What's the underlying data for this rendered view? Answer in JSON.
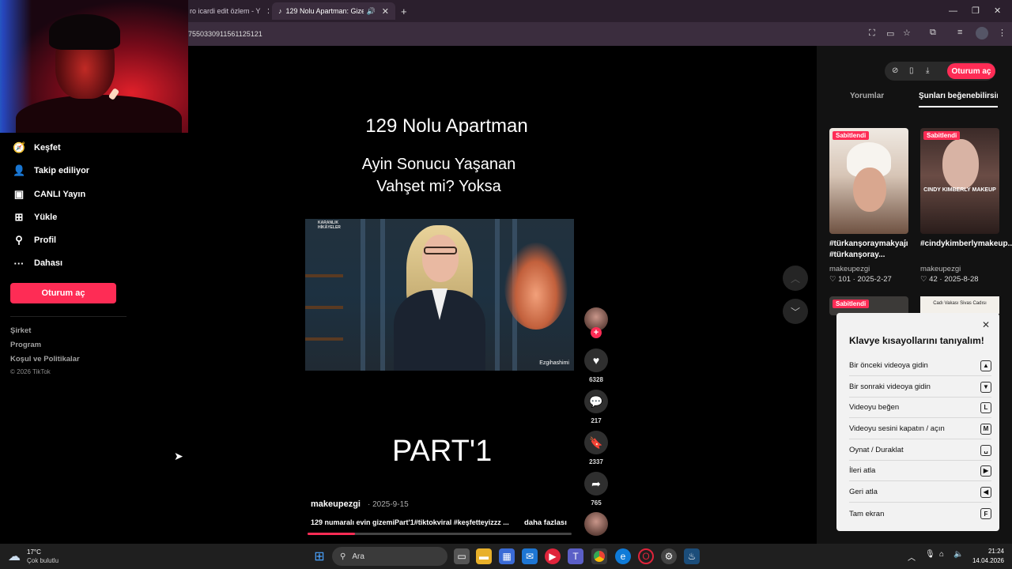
{
  "browser": {
    "tabs": [
      {
        "title": "ro icardi edit özlem - Y"
      },
      {
        "title": "129 Nolu Apartman: Gizem"
      }
    ],
    "url": "7550330911561125121"
  },
  "sidebar": {
    "items": [
      {
        "label": "Keşfet",
        "icon": "compass-icon"
      },
      {
        "label": "Takip ediliyor",
        "icon": "following-icon"
      },
      {
        "label": "CANLI Yayın",
        "icon": "live-icon"
      },
      {
        "label": "Yükle",
        "icon": "upload-icon"
      },
      {
        "label": "Profil",
        "icon": "profile-icon"
      },
      {
        "label": "Dahası",
        "icon": "more-icon"
      }
    ],
    "login_label": "Oturum aç",
    "footer_links": [
      "Şirket",
      "Program",
      "Koşul ve Politikalar"
    ],
    "copyright": "© 2026 TikTok"
  },
  "video": {
    "title": "129 Nolu Apartman",
    "subtitle_line1": "Ayin Sonucu Yaşanan",
    "subtitle_line2": "Vahşet mi? Yoksa",
    "brand_line1": "KARANLIK",
    "brand_line2": "HİKÂYELER",
    "watermark": "Ezgihashimi",
    "part_label": "PART'1",
    "author": "makeupezgi",
    "date": "· 2025-9-15",
    "description": "129 numaralı evin gizemiPart'1#tiktokviral #keşfetteyizzz ...",
    "more_label": "daha fazlası",
    "progress": 0.18
  },
  "actions": {
    "likes": "6328",
    "comments": "217",
    "saves": "2337",
    "shares": "765"
  },
  "right_panel": {
    "login_label": "Oturum aç",
    "tab_comments": "Yorumlar",
    "tab_suggested": "Şunları beğenebilirsin",
    "cards": [
      {
        "pinned": "Sabitlendi",
        "title": "#türkanşoraymakyajı #türkanşoray...",
        "user": "makeupezgi",
        "likes": "101",
        "date": "2025-2-27"
      },
      {
        "pinned": "Sabitlendi",
        "title": "#cindykimberlymakeup...",
        "user": "makeupezgi",
        "likes": "42",
        "date": "2025-8-28",
        "overlay": "CINDY KIMBERLY MAKEUP"
      },
      {
        "pinned": "Sabitlendi"
      },
      {
        "overlay": "Cadı Vakası Sivas Cadısı"
      }
    ]
  },
  "shortcuts": {
    "title": "Klavye kısayollarını tanıyalım!",
    "rows": [
      {
        "label": "Bir önceki videoya gidin",
        "key": "▲"
      },
      {
        "label": "Bir sonraki videoya gidin",
        "key": "▼"
      },
      {
        "label": "Videoyu beğen",
        "key": "L"
      },
      {
        "label": "Videoyu sesini kapatın / açın",
        "key": "M"
      },
      {
        "label": "Oynat / Duraklat",
        "key": "␣"
      },
      {
        "label": "İleri atla",
        "key": "▶"
      },
      {
        "label": "Geri atla",
        "key": "◀"
      },
      {
        "label": "Tam ekran",
        "key": "F"
      }
    ]
  },
  "taskbar": {
    "weather_temp": "17°C",
    "weather_desc": "Çok bulutlu",
    "search_label": "Ara",
    "time": "21:24",
    "date": "14.04.2026"
  },
  "colors": {
    "accent": "#fe2c55",
    "browser_bg": "#2b1f2d",
    "panel_bg": "#121212"
  }
}
